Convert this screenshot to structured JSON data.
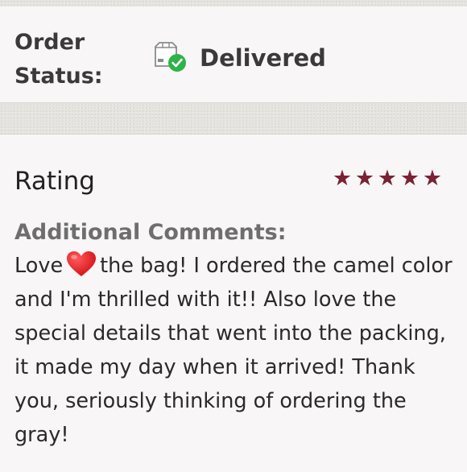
{
  "order_status": {
    "label": "Order Status:",
    "value": "Delivered",
    "icon": "delivered-box-icon",
    "check_color": "#2db34a"
  },
  "review": {
    "rating_label": "Rating",
    "stars": 5,
    "star_color": "#7a2134",
    "comments_label": "Additional Comments:",
    "comment_before_emoji": "Love",
    "emoji": "red-heart-icon",
    "comment_after_emoji": "the bag! I ordered the camel color and I'm thrilled with it!! Also love the special details that went into the packing, it made my day when it arrived! Thank you, seriously thinking of ordering the gray!"
  }
}
